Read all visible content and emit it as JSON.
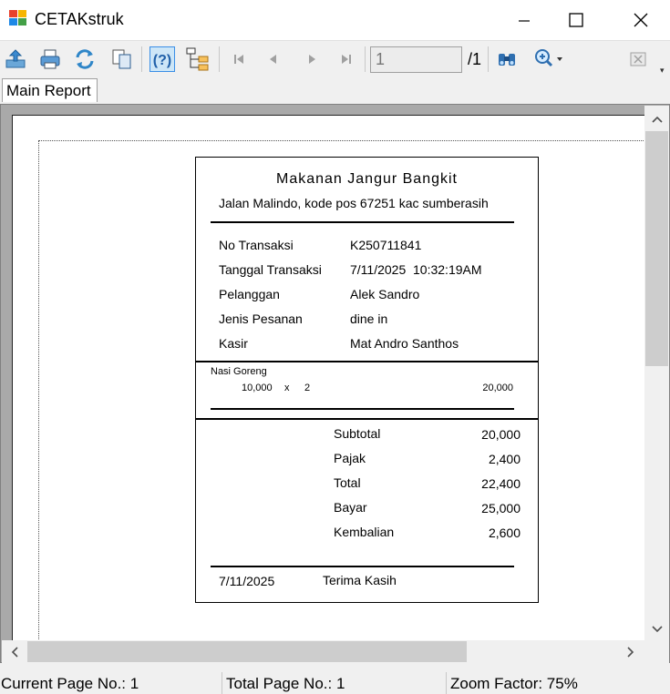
{
  "window": {
    "title": "CETAKstruk",
    "minimize_glyph": "—",
    "maximize_glyph": "☐",
    "close_glyph": "✕"
  },
  "toolbar": {
    "icons": [
      "export-icon",
      "print-icon",
      "refresh-icon",
      "copy-icon",
      "help-icon",
      "group-tree-icon",
      "first-page-icon",
      "prev-page-icon",
      "next-page-icon",
      "last-page-icon",
      "find-icon",
      "zoom-icon",
      "close-view-icon"
    ],
    "current_page": "1",
    "total_pages": "/1"
  },
  "tabs": [
    {
      "label": "Main Report"
    }
  ],
  "receipt": {
    "store_name": "Makanan Jangur Bangkit",
    "address": "Jalan Malindo, kode pos 67251 kac sumberasih",
    "info": [
      {
        "label": "No Transaksi",
        "value": "K250711841"
      },
      {
        "label": "Tanggal Transaksi",
        "value": "7/11/2025  10:32:19AM"
      },
      {
        "label": "Pelanggan",
        "value": "Alek Sandro"
      },
      {
        "label": "Jenis Pesanan",
        "value": "dine in"
      },
      {
        "label": "Kasir",
        "value": "Mat Andro Santhos"
      }
    ],
    "items": [
      {
        "name": "Nasi Goreng",
        "price": "10,000",
        "x": "x",
        "qty": "2",
        "total": "20,000"
      }
    ],
    "summary": [
      {
        "label": "Subtotal",
        "value": "20,000"
      },
      {
        "label": "Pajak",
        "value": "2,400"
      },
      {
        "label": "Total",
        "value": "22,400"
      },
      {
        "label": "Bayar",
        "value": "25,000"
      },
      {
        "label": "Kembalian",
        "value": "2,600"
      }
    ],
    "footer_date": "7/11/2025",
    "footer_thanks": "Terima Kasih"
  },
  "statusbar": {
    "current_page": "Current Page No.: 1",
    "total_page": "Total Page No.: 1",
    "zoom": "Zoom Factor: 75%"
  }
}
